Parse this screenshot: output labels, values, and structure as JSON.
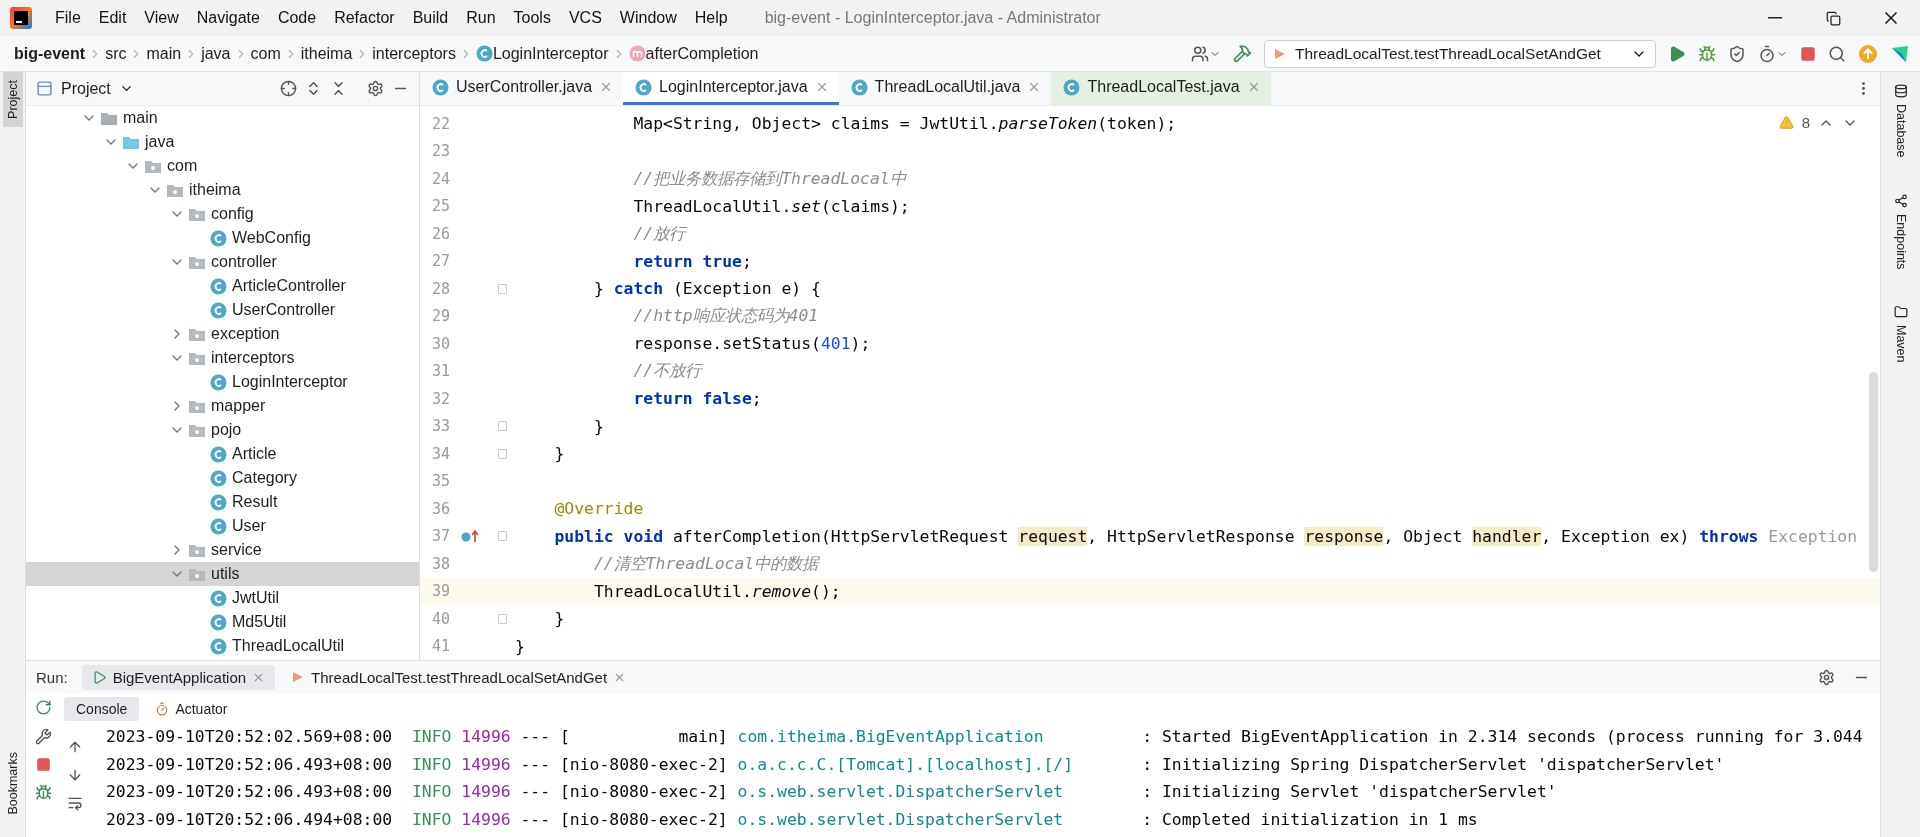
{
  "window": {
    "title": "big-event - LoginInterceptor.java - Administrator"
  },
  "menu": [
    "File",
    "Edit",
    "View",
    "Navigate",
    "Code",
    "Refactor",
    "Build",
    "Run",
    "Tools",
    "VCS",
    "Window",
    "Help"
  ],
  "breadcrumb": [
    {
      "kind": "project",
      "label": "big-event"
    },
    {
      "kind": "folder",
      "label": "src"
    },
    {
      "kind": "folder",
      "label": "main"
    },
    {
      "kind": "folder",
      "label": "java"
    },
    {
      "kind": "folder",
      "label": "com"
    },
    {
      "kind": "folder",
      "label": "itheima"
    },
    {
      "kind": "folder",
      "label": "interceptors"
    },
    {
      "kind": "class",
      "label": "LoginInterceptor"
    },
    {
      "kind": "method",
      "label": "afterCompletion"
    }
  ],
  "run_config": {
    "label": "ThreadLocalTest.testThreadLocalSetAndGet"
  },
  "left_stripe": {
    "top": [
      {
        "label": "Project",
        "selected": true
      }
    ],
    "bottom": [
      {
        "label": "Bookmarks",
        "selected": false
      }
    ]
  },
  "project_panel": {
    "title": "Project",
    "tree": [
      {
        "kind": "directory",
        "label": "main",
        "expanded": true,
        "selected": false,
        "children": [
          {
            "kind": "source-root",
            "label": "java",
            "expanded": true,
            "selected": false,
            "children": [
              {
                "kind": "package",
                "label": "com",
                "expanded": true,
                "selected": false,
                "children": [
                  {
                    "kind": "package",
                    "label": "itheima",
                    "expanded": true,
                    "selected": false,
                    "children": [
                      {
                        "kind": "package",
                        "label": "config",
                        "expanded": true,
                        "selected": false,
                        "children": [
                          {
                            "kind": "class",
                            "label": "WebConfig",
                            "selected": false
                          }
                        ]
                      },
                      {
                        "kind": "package",
                        "label": "controller",
                        "expanded": true,
                        "selected": false,
                        "children": [
                          {
                            "kind": "class",
                            "label": "ArticleController",
                            "selected": false
                          },
                          {
                            "kind": "class",
                            "label": "UserController",
                            "selected": false
                          }
                        ]
                      },
                      {
                        "kind": "package",
                        "label": "exception",
                        "expanded": false,
                        "selected": false
                      },
                      {
                        "kind": "package",
                        "label": "interceptors",
                        "expanded": true,
                        "selected": false,
                        "children": [
                          {
                            "kind": "class",
                            "label": "LoginInterceptor",
                            "selected": false
                          }
                        ]
                      },
                      {
                        "kind": "package",
                        "label": "mapper",
                        "expanded": false,
                        "selected": false
                      },
                      {
                        "kind": "package",
                        "label": "pojo",
                        "expanded": true,
                        "selected": false,
                        "children": [
                          {
                            "kind": "class",
                            "label": "Article",
                            "selected": false
                          },
                          {
                            "kind": "class",
                            "label": "Category",
                            "selected": false
                          },
                          {
                            "kind": "class",
                            "label": "Result",
                            "selected": false
                          },
                          {
                            "kind": "class",
                            "label": "User",
                            "selected": false
                          }
                        ]
                      },
                      {
                        "kind": "package",
                        "label": "service",
                        "expanded": false,
                        "selected": false
                      },
                      {
                        "kind": "package",
                        "label": "utils",
                        "expanded": true,
                        "selected": true,
                        "children": [
                          {
                            "kind": "class",
                            "label": "JwtUtil",
                            "selected": false
                          },
                          {
                            "kind": "class",
                            "label": "Md5Util",
                            "selected": false
                          },
                          {
                            "kind": "class",
                            "label": "ThreadLocalUtil",
                            "selected": false
                          }
                        ]
                      }
                    ]
                  }
                ]
              }
            ]
          }
        ]
      }
    ]
  },
  "editor_tabs": [
    {
      "label": "UserController.java",
      "selected": false,
      "color": "#f7f8fa"
    },
    {
      "label": "LoginInterceptor.java",
      "selected": true,
      "color": "#ffffff"
    },
    {
      "label": "ThreadLocalUtil.java",
      "selected": false,
      "color": "#f7f8fa"
    },
    {
      "label": "ThreadLocalTest.java",
      "selected": false,
      "color": "#e4f1e0"
    }
  ],
  "editor": {
    "warnings": "8",
    "lines": [
      {
        "number": "22",
        "current": false,
        "fold": false,
        "override": false,
        "tokens": [
          {
            "kind": "plain",
            "text": "            Map<String, Object> claims = JwtUtil."
          },
          {
            "kind": "static",
            "text": "parseToken"
          },
          {
            "kind": "plain",
            "text": "(token);"
          }
        ]
      },
      {
        "number": "23",
        "current": false,
        "fold": false,
        "override": false
      },
      {
        "number": "24",
        "current": false,
        "fold": false,
        "override": false,
        "tokens": [
          {
            "kind": "comment",
            "text": "            //把业务数据存储到ThreadLocal中"
          }
        ]
      },
      {
        "number": "25",
        "current": false,
        "fold": false,
        "override": false,
        "tokens": [
          {
            "kind": "plain",
            "text": "            ThreadLocalUtil."
          },
          {
            "kind": "static",
            "text": "set"
          },
          {
            "kind": "plain",
            "text": "(claims);"
          }
        ]
      },
      {
        "number": "26",
        "current": false,
        "fold": false,
        "override": false,
        "tokens": [
          {
            "kind": "comment",
            "text": "            //放行"
          }
        ]
      },
      {
        "number": "27",
        "current": false,
        "fold": false,
        "override": false,
        "tokens": [
          {
            "kind": "keyword",
            "text": "            return true"
          },
          {
            "kind": "plain",
            "text": ";"
          }
        ]
      },
      {
        "number": "28",
        "current": false,
        "fold": true,
        "override": false,
        "tokens": [
          {
            "kind": "plain",
            "text": "        } "
          },
          {
            "kind": "keyword",
            "text": "catch"
          },
          {
            "kind": "plain",
            "text": " (Exception e) {"
          }
        ]
      },
      {
        "number": "29",
        "current": false,
        "fold": false,
        "override": false,
        "tokens": [
          {
            "kind": "comment",
            "text": "            //http响应状态码为401"
          }
        ]
      },
      {
        "number": "30",
        "current": false,
        "fold": false,
        "override": false,
        "tokens": [
          {
            "kind": "plain",
            "text": "            response.setStatus("
          },
          {
            "kind": "number",
            "text": "401"
          },
          {
            "kind": "plain",
            "text": ");"
          }
        ]
      },
      {
        "number": "31",
        "current": false,
        "fold": false,
        "override": false,
        "tokens": [
          {
            "kind": "comment",
            "text": "            //不放行"
          }
        ]
      },
      {
        "number": "32",
        "current": false,
        "fold": false,
        "override": false,
        "tokens": [
          {
            "kind": "keyword",
            "text": "            return false"
          },
          {
            "kind": "plain",
            "text": ";"
          }
        ]
      },
      {
        "number": "33",
        "current": false,
        "fold": true,
        "override": false,
        "tokens": [
          {
            "kind": "plain",
            "text": "        }"
          }
        ]
      },
      {
        "number": "34",
        "current": false,
        "fold": true,
        "override": false,
        "tokens": [
          {
            "kind": "plain",
            "text": "    }"
          }
        ]
      },
      {
        "number": "35",
        "current": false,
        "fold": false,
        "override": false
      },
      {
        "number": "36",
        "current": false,
        "fold": false,
        "override": false,
        "tokens": [
          {
            "kind": "annotation",
            "text": "    @Override"
          }
        ]
      },
      {
        "number": "37",
        "current": false,
        "fold": true,
        "override": true,
        "tokens": [
          {
            "kind": "keyword",
            "text": "    public void"
          },
          {
            "kind": "plain",
            "text": " afterCompletion(HttpServletRequest "
          },
          {
            "kind": "param",
            "text": "request"
          },
          {
            "kind": "plain",
            "text": ", HttpServletResponse "
          },
          {
            "kind": "param",
            "text": "response"
          },
          {
            "kind": "plain",
            "text": ", Object "
          },
          {
            "kind": "param",
            "text": "handler"
          },
          {
            "kind": "plain",
            "text": ", Exception ex) "
          },
          {
            "kind": "keyword",
            "text": "throws"
          },
          {
            "kind": "muted",
            "text": " Exception"
          }
        ]
      },
      {
        "number": "38",
        "current": false,
        "fold": false,
        "override": false,
        "tokens": [
          {
            "kind": "comment",
            "text": "        //清空ThreadLocal中的数据"
          }
        ]
      },
      {
        "number": "39",
        "current": true,
        "fold": false,
        "override": false,
        "tokens": [
          {
            "kind": "plain",
            "text": "        ThreadLocalUtil."
          },
          {
            "kind": "static",
            "text": "remove"
          },
          {
            "kind": "plain",
            "text": "();"
          }
        ]
      },
      {
        "number": "40",
        "current": false,
        "fold": true,
        "override": false,
        "tokens": [
          {
            "kind": "plain",
            "text": "    }"
          }
        ]
      },
      {
        "number": "41",
        "current": false,
        "fold": false,
        "override": false,
        "tokens": [
          {
            "kind": "plain",
            "text": "}"
          }
        ]
      }
    ]
  },
  "right_stripe": [
    "Database",
    "Endpoints",
    "Maven"
  ],
  "run_panel": {
    "label": "Run:",
    "tabs": [
      {
        "kind": "app",
        "label": "BigEventApplication",
        "selected": true
      },
      {
        "kind": "test",
        "label": "ThreadLocalTest.testThreadLocalSetAndGet",
        "selected": false
      }
    ],
    "console_tabs": [
      {
        "kind": "console",
        "label": "Console",
        "selected": true
      },
      {
        "kind": "actuator",
        "label": "Actuator",
        "selected": false
      }
    ],
    "log": [
      {
        "tokens": [
          {
            "kind": "plain",
            "text": "2023-09-10T20:52:02.569+08:00  "
          },
          {
            "kind": "level",
            "text": "INFO"
          },
          {
            "kind": "pid",
            "text": " 14996"
          },
          {
            "kind": "plain",
            "text": " --- [           main] "
          },
          {
            "kind": "logger",
            "text": "com.itheima.BigEventApplication"
          },
          {
            "kind": "plain",
            "text": "          : Started BigEventApplication in 2.314 seconds (process running for 3.044"
          }
        ]
      },
      {
        "tokens": [
          {
            "kind": "plain",
            "text": "2023-09-10T20:52:06.493+08:00  "
          },
          {
            "kind": "level",
            "text": "INFO"
          },
          {
            "kind": "pid",
            "text": " 14996"
          },
          {
            "kind": "plain",
            "text": " --- [nio-8080-exec-2] "
          },
          {
            "kind": "logger",
            "text": "o.a.c.c.C.[Tomcat].[localhost].[/]"
          },
          {
            "kind": "plain",
            "text": "       : Initializing Spring DispatcherServlet 'dispatcherServlet'"
          }
        ]
      },
      {
        "tokens": [
          {
            "kind": "plain",
            "text": "2023-09-10T20:52:06.493+08:00  "
          },
          {
            "kind": "level",
            "text": "INFO"
          },
          {
            "kind": "pid",
            "text": " 14996"
          },
          {
            "kind": "plain",
            "text": " --- [nio-8080-exec-2] "
          },
          {
            "kind": "logger",
            "text": "o.s.web.servlet.DispatcherServlet"
          },
          {
            "kind": "plain",
            "text": "        : Initializing Servlet 'dispatcherServlet'"
          }
        ]
      },
      {
        "tokens": [
          {
            "kind": "plain",
            "text": "2023-09-10T20:52:06.494+08:00  "
          },
          {
            "kind": "level",
            "text": "INFO"
          },
          {
            "kind": "pid",
            "text": " 14996"
          },
          {
            "kind": "plain",
            "text": " --- [nio-8080-exec-2] "
          },
          {
            "kind": "logger",
            "text": "o.s.web.servlet.DispatcherServlet"
          },
          {
            "kind": "plain",
            "text": "        : Completed initialization in 1 ms"
          }
        ]
      }
    ]
  }
}
